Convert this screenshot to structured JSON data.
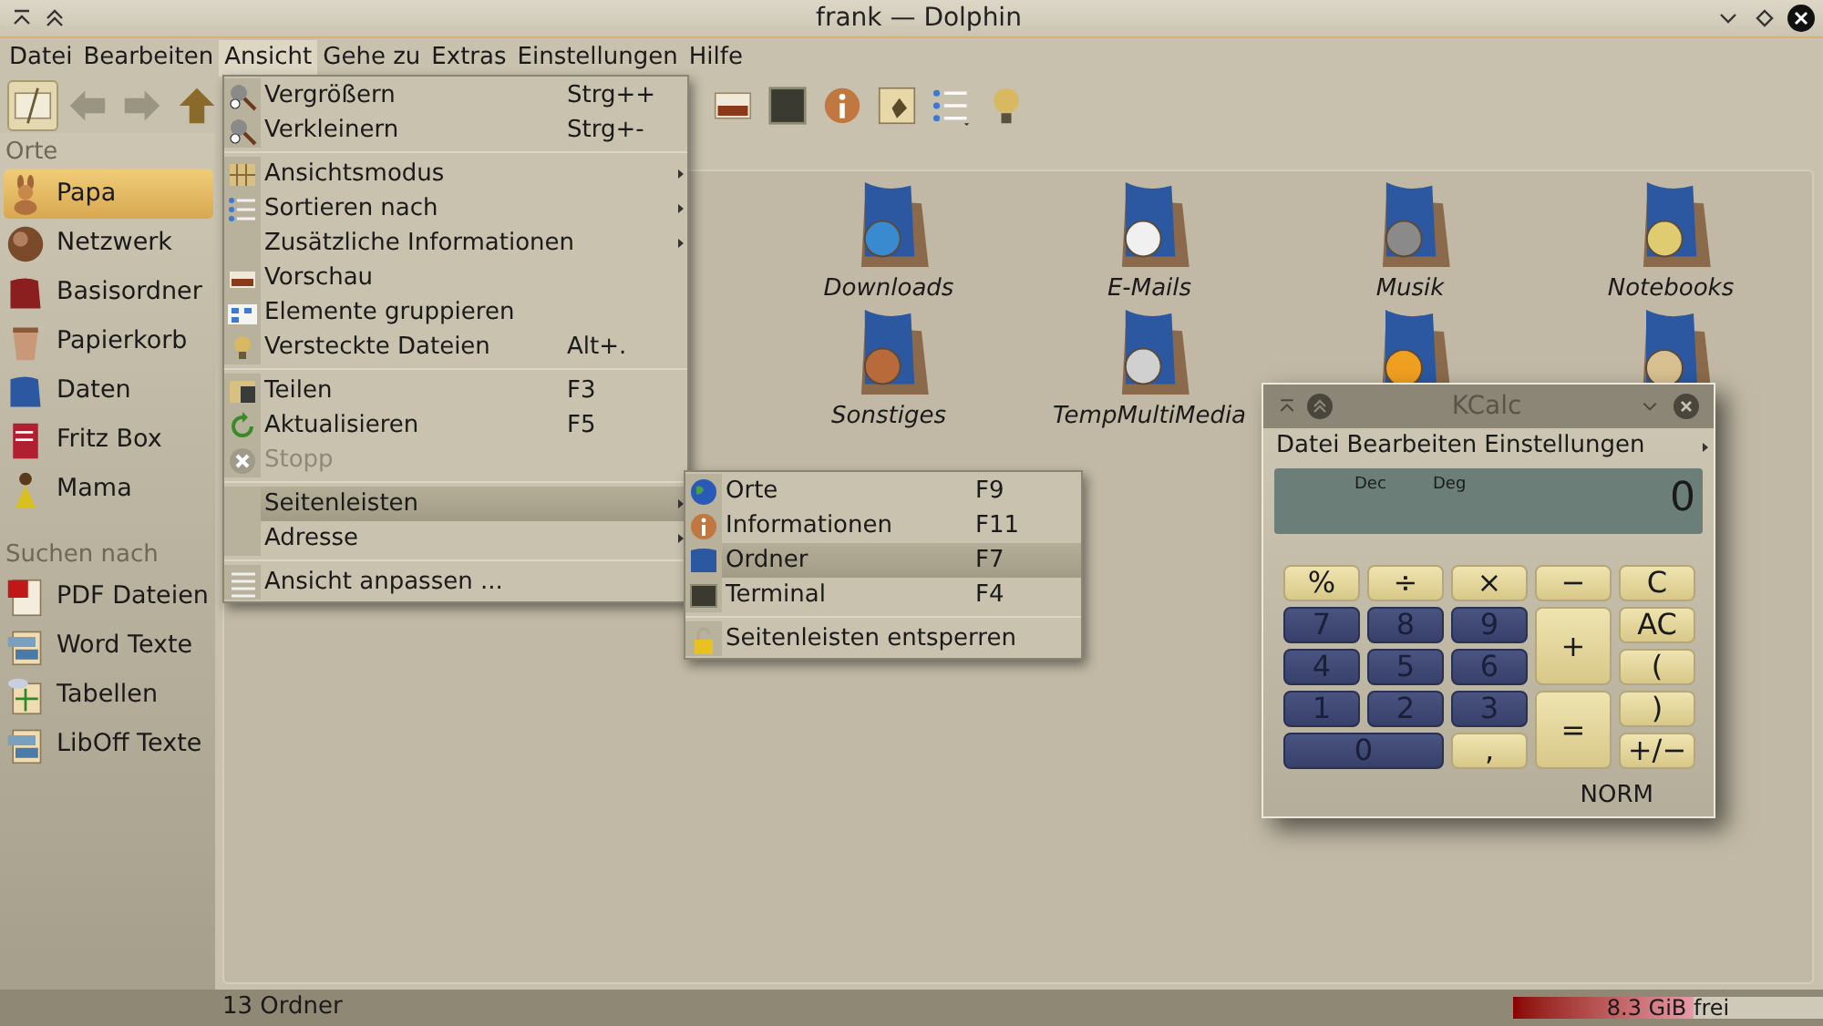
{
  "window": {
    "title": "frank — Dolphin"
  },
  "menubar": [
    {
      "label": "Datei",
      "selected": false
    },
    {
      "label": "Bearbeiten",
      "selected": false
    },
    {
      "label": "Ansicht",
      "selected": true
    },
    {
      "label": "Gehe zu",
      "selected": false
    },
    {
      "label": "Extras",
      "selected": false
    },
    {
      "label": "Einstellungen",
      "selected": false
    },
    {
      "label": "Hilfe",
      "selected": false
    }
  ],
  "toolbar": {
    "file_view_toggle": {
      "checked": true
    }
  },
  "sidebar": {
    "sections": [
      {
        "title": "Orte",
        "items": [
          {
            "label": "Papa",
            "selected": true
          },
          {
            "label": "Netzwerk",
            "selected": false
          },
          {
            "label": "Basisordner",
            "selected": false
          },
          {
            "label": "Papierkorb",
            "selected": false
          },
          {
            "label": "Daten",
            "selected": false
          },
          {
            "label": "Fritz Box",
            "selected": false
          },
          {
            "label": "Mama",
            "selected": false
          }
        ]
      },
      {
        "title": "Suchen nach",
        "items": [
          {
            "label": "PDF Dateien",
            "selected": false
          },
          {
            "label": "Word Texte",
            "selected": false
          },
          {
            "label": "Tabellen",
            "selected": false
          },
          {
            "label": "LibOff Texte",
            "selected": false
          }
        ]
      }
    ]
  },
  "content": {
    "rows": [
      [
        {
          "kind": "folder",
          "name": "Downloads"
        },
        {
          "kind": "folder",
          "name": "E-Mails"
        },
        {
          "kind": "folder",
          "name": "Musik"
        },
        {
          "kind": "folder",
          "name": "Notebooks"
        }
      ],
      [
        {
          "kind": "folder",
          "name": "Sonstiges"
        },
        {
          "kind": "folder",
          "name": "TempMultiMedia"
        },
        {
          "kind": "folder"
        },
        {
          "kind": "folder"
        }
      ]
    ]
  },
  "view_menu": {
    "groups": [
      [
        {
          "label": "Vergrößern",
          "shortcut": "Strg++",
          "submenu": false,
          "disabled": false,
          "selected": false
        },
        {
          "label": "Verkleinern",
          "shortcut": "Strg+-",
          "submenu": false,
          "disabled": false,
          "selected": false
        }
      ],
      [
        {
          "label": "Ansichtsmodus",
          "submenu": true,
          "disabled": false,
          "selected": false
        },
        {
          "label": "Sortieren nach",
          "submenu": true,
          "disabled": false,
          "selected": false
        },
        {
          "label": "Zusätzliche Informationen",
          "submenu": true,
          "disabled": false,
          "selected": false
        },
        {
          "label": "Vorschau",
          "submenu": false,
          "disabled": false,
          "selected": false
        },
        {
          "label": "Elemente gruppieren",
          "submenu": false,
          "disabled": false,
          "selected": false
        },
        {
          "label": "Versteckte Dateien",
          "shortcut": "Alt+.",
          "submenu": false,
          "disabled": false,
          "selected": false
        }
      ],
      [
        {
          "label": "Teilen",
          "shortcut": "F3",
          "submenu": false,
          "disabled": false,
          "selected": false
        },
        {
          "label": "Aktualisieren",
          "shortcut": "F5",
          "submenu": false,
          "disabled": false,
          "selected": false
        },
        {
          "label": "Stopp",
          "submenu": false,
          "disabled": true,
          "selected": false
        }
      ],
      [
        {
          "label": "Seitenleisten",
          "submenu": true,
          "disabled": false,
          "selected": true
        },
        {
          "label": "Adresse",
          "submenu": true,
          "disabled": false,
          "selected": false
        }
      ],
      [
        {
          "label": "Ansicht anpassen ...",
          "submenu": false,
          "disabled": false,
          "selected": false
        }
      ]
    ]
  },
  "panels_menu": {
    "groups": [
      [
        {
          "label": "Orte",
          "shortcut": "F9",
          "selected": false
        },
        {
          "label": "Informationen",
          "shortcut": "F11",
          "selected": false
        },
        {
          "label": "Ordner",
          "shortcut": "F7",
          "selected": true
        },
        {
          "label": "Terminal",
          "shortcut": "F4",
          "selected": false
        }
      ],
      [
        {
          "label": "Seitenleisten entsperren",
          "selected": false
        }
      ]
    ]
  },
  "kcalc": {
    "title": "KCalc",
    "menu": [
      "Datei",
      "Bearbeiten",
      "Einstellungen"
    ],
    "display": {
      "base": "Dec",
      "angle": "Deg",
      "value": "0"
    },
    "buttons": [
      {
        "label": "%",
        "kind": "op",
        "tall": false,
        "wide": false
      },
      {
        "label": "÷",
        "kind": "op",
        "tall": false,
        "wide": false
      },
      {
        "label": "×",
        "kind": "op",
        "tall": false,
        "wide": false
      },
      {
        "label": "−",
        "kind": "op",
        "tall": false,
        "wide": false
      },
      {
        "label": "C",
        "kind": "op",
        "tall": false,
        "wide": false
      },
      {
        "label": "7",
        "kind": "num",
        "tall": false,
        "wide": false
      },
      {
        "label": "8",
        "kind": "num",
        "tall": false,
        "wide": false
      },
      {
        "label": "9",
        "kind": "num",
        "tall": false,
        "wide": false
      },
      {
        "label": "+",
        "kind": "op",
        "tall": true,
        "wide": false
      },
      {
        "label": "AC",
        "kind": "op",
        "tall": false,
        "wide": false
      },
      {
        "label": "4",
        "kind": "num",
        "tall": false,
        "wide": false
      },
      {
        "label": "5",
        "kind": "num",
        "tall": false,
        "wide": false
      },
      {
        "label": "6",
        "kind": "num",
        "tall": false,
        "wide": false
      },
      {
        "label": "(",
        "kind": "op",
        "tall": false,
        "wide": false
      },
      {
        "label": "1",
        "kind": "num",
        "tall": false,
        "wide": false
      },
      {
        "label": "2",
        "kind": "num",
        "tall": false,
        "wide": false
      },
      {
        "label": "3",
        "kind": "num",
        "tall": false,
        "wide": false
      },
      {
        "label": "=",
        "kind": "op",
        "tall": true,
        "wide": false
      },
      {
        "label": ")",
        "kind": "op",
        "tall": false,
        "wide": false
      },
      {
        "label": "0",
        "kind": "num",
        "tall": false,
        "wide": true
      },
      {
        "label": ",",
        "kind": "op",
        "tall": false,
        "wide": false
      },
      {
        "label": "+/−",
        "kind": "op",
        "tall": false,
        "wide": false
      }
    ],
    "status": "NORM"
  },
  "status_bar": {
    "text": "13 Ordner",
    "free_space": {
      "label": "8.3 GiB frei",
      "level": 0.58
    }
  }
}
